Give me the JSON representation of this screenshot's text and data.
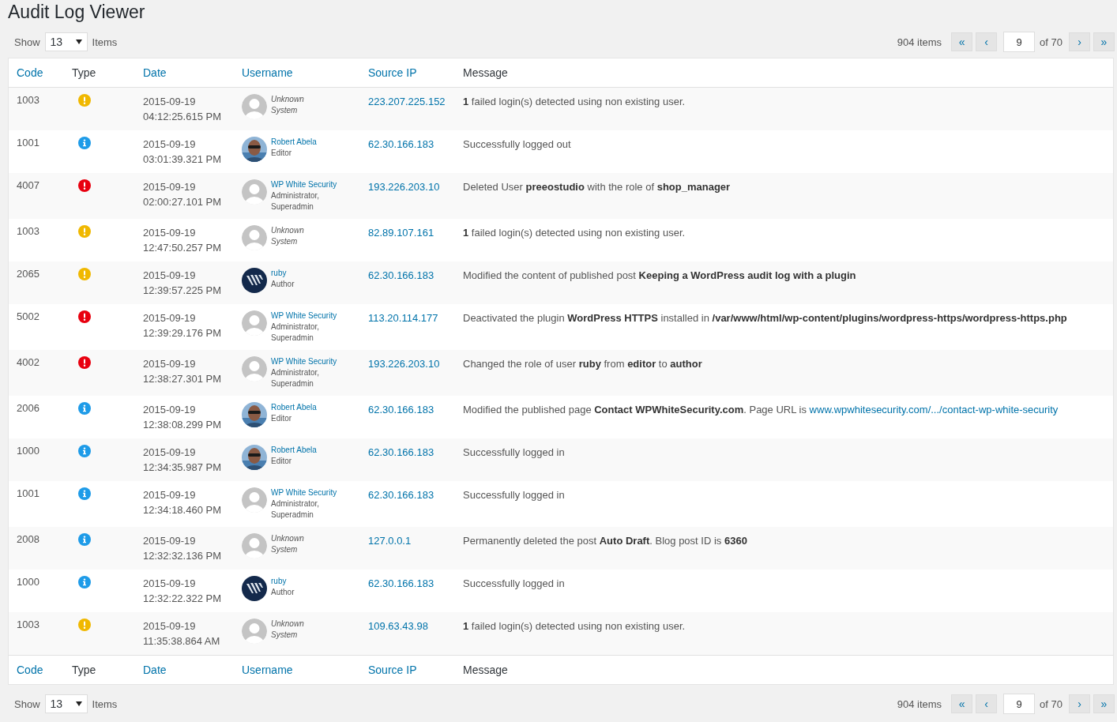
{
  "title": "Audit Log Viewer",
  "top_bar": {
    "show_label": "Show",
    "per_page": "13",
    "items_label": "Items",
    "total": "904 items",
    "first": "«",
    "prev": "‹",
    "page": "9",
    "of": "of 70",
    "next": "›",
    "last": "»"
  },
  "columns": [
    {
      "label": "Code",
      "sortable": true
    },
    {
      "label": "Type",
      "sortable": false
    },
    {
      "label": "Date",
      "sortable": true
    },
    {
      "label": "Username",
      "sortable": true
    },
    {
      "label": "Source IP",
      "sortable": true
    },
    {
      "label": "Message",
      "sortable": false
    }
  ],
  "rows": [
    {
      "code": "1003",
      "kind": "warning",
      "date": "2015-09-19",
      "time": "04:12:25.615 PM",
      "avatar": {
        "kind": "default"
      },
      "system": true,
      "user": "Unknown",
      "role": "System",
      "ip": "223.207.225.152",
      "message": "**1** failed login(s) detected using non existing user."
    },
    {
      "code": "1001",
      "kind": "info",
      "date": "2015-09-19",
      "time": "03:01:39.321 PM",
      "avatar": {
        "kind": "photo"
      },
      "system": false,
      "user": "Robert Abela",
      "role": "Editor",
      "ip": "62.30.166.183",
      "message": "Successfully logged out"
    },
    {
      "code": "4007",
      "kind": "error",
      "date": "2015-09-19",
      "time": "02:00:27.101 PM",
      "avatar": {
        "kind": "default"
      },
      "system": false,
      "user": "WP White Security",
      "role": "Administrator, Superadmin",
      "ip": "193.226.203.10",
      "message": "Deleted User **preeostudio** with the role of **shop_manager**"
    },
    {
      "code": "1003",
      "kind": "warning",
      "date": "2015-09-19",
      "time": "12:47:50.257 PM",
      "avatar": {
        "kind": "default"
      },
      "system": true,
      "user": "Unknown",
      "role": "System",
      "ip": "82.89.107.161",
      "message": "**1** failed login(s) detected using non existing user."
    },
    {
      "code": "2065",
      "kind": "warning",
      "date": "2015-09-19",
      "time": "12:39:57.225 PM",
      "avatar": {
        "kind": "logo"
      },
      "system": false,
      "user": "ruby",
      "role": "Author",
      "ip": "62.30.166.183",
      "message": "Modified the content of published post **Keeping a WordPress audit log with a plugin**"
    },
    {
      "code": "5002",
      "kind": "error",
      "date": "2015-09-19",
      "time": "12:39:29.176 PM",
      "avatar": {
        "kind": "default"
      },
      "system": false,
      "user": "WP White Security",
      "role": "Administrator, Superadmin",
      "ip": "113.20.114.177",
      "message": "Deactivated the plugin **WordPress HTTPS** installed in **/var/www/html/wp-content/plugins/wordpress-https/wordpress-https.php**"
    },
    {
      "code": "4002",
      "kind": "error",
      "date": "2015-09-19",
      "time": "12:38:27.301 PM",
      "avatar": {
        "kind": "default"
      },
      "system": false,
      "user": "WP White Security",
      "role": "Administrator, Superadmin",
      "ip": "193.226.203.10",
      "message": "Changed the role of user **ruby** from **editor** to **author**"
    },
    {
      "code": "2006",
      "kind": "info",
      "date": "2015-09-19",
      "time": "12:38:08.299 PM",
      "avatar": {
        "kind": "photo"
      },
      "system": false,
      "user": "Robert Abela",
      "role": "Editor",
      "ip": "62.30.166.183",
      "message": "Modified the published page **Contact WPWhiteSecurity.com**. Page URL is",
      "link": "www.wpwhitesecurity.com/.../contact-wp-white-security"
    },
    {
      "code": "1000",
      "kind": "info",
      "date": "2015-09-19",
      "time": "12:34:35.987 PM",
      "avatar": {
        "kind": "photo"
      },
      "system": false,
      "user": "Robert Abela",
      "role": "Editor",
      "ip": "62.30.166.183",
      "message": "Successfully logged in"
    },
    {
      "code": "1001",
      "kind": "info",
      "date": "2015-09-19",
      "time": "12:34:18.460 PM",
      "avatar": {
        "kind": "default"
      },
      "system": false,
      "user": "WP White Security",
      "role": "Administrator, Superadmin",
      "ip": "62.30.166.183",
      "message": "Successfully logged in"
    },
    {
      "code": "2008",
      "kind": "info",
      "date": "2015-09-19",
      "time": "12:32:32.136 PM",
      "avatar": {
        "kind": "default"
      },
      "system": true,
      "user": "Unknown",
      "role": "System",
      "ip": "127.0.0.1",
      "message": "Permanently deleted the post **Auto Draft**. Blog post ID is **6360**"
    },
    {
      "code": "1000",
      "kind": "info",
      "date": "2015-09-19",
      "time": "12:32:22.322 PM",
      "avatar": {
        "kind": "logo"
      },
      "system": false,
      "user": "ruby",
      "role": "Author",
      "ip": "62.30.166.183",
      "message": "Successfully logged in"
    },
    {
      "code": "1003",
      "kind": "warning",
      "date": "2015-09-19",
      "time": "11:35:38.864 AM",
      "avatar": {
        "kind": "default"
      },
      "system": true,
      "user": "Unknown",
      "role": "System",
      "ip": "109.63.43.98",
      "message": "**1** failed login(s) detected using non existing user."
    }
  ],
  "footer_columns": [
    {
      "label": "Code",
      "sortable": true
    },
    {
      "label": "Type",
      "sortable": false
    },
    {
      "label": "Date",
      "sortable": true
    },
    {
      "label": "Username",
      "sortable": true
    },
    {
      "label": "Source IP",
      "sortable": true
    },
    {
      "label": "Message",
      "sortable": false
    }
  ],
  "bottom_bar": {
    "show_label": "Show",
    "per_page": "13",
    "items_label": "Items",
    "total": "904 items",
    "first": "«",
    "prev": "‹",
    "page": "9",
    "of": "of 70",
    "next": "›",
    "last": "»"
  }
}
